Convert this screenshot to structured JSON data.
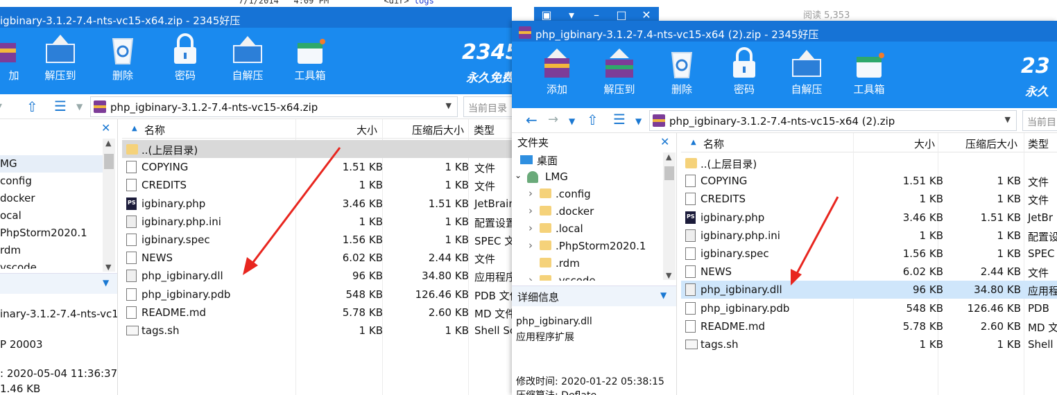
{
  "background": {
    "listing_date": "7/1/2014",
    "listing_time": "4:09 PM",
    "listing_dir": "<dir>",
    "listing_name": "logs",
    "read_count": "阅读 5,353"
  },
  "left_window": {
    "title": "igbinary-3.1.2-7.4-nts-vc15-x64.zip - 2345好压",
    "toolbar": [
      "加",
      "解压到",
      "删除",
      "密码",
      "自解压",
      "工具箱"
    ],
    "brand": "2345",
    "brand_sub": "永久免费",
    "path": "php_igbinary-3.1.2-7.4-nts-vc15-x64.zip",
    "search_placeholder": "当前目录",
    "tree": [
      "MG",
      "config",
      "docker",
      "ocal",
      "PhpStorm2020.1",
      "rdm",
      "vscode"
    ],
    "details": {
      "name": "inary-3.1.2-7.4-nts-vc15",
      "line2": "P 20003",
      "modified": ":  2020-05-04 11:36:37",
      "size": "1.46 KB"
    },
    "columns": {
      "name": "名称",
      "size": "大小",
      "packed": "压缩后大小",
      "type": "类型"
    },
    "files": [
      {
        "name": "..(上层目录)",
        "size": "",
        "packed": "",
        "type": ""
      },
      {
        "name": "COPYING",
        "size": "1.51 KB",
        "packed": "1 KB",
        "type": "文件"
      },
      {
        "name": "CREDITS",
        "size": "1 KB",
        "packed": "1 KB",
        "type": "文件"
      },
      {
        "name": "igbinary.php",
        "size": "3.46 KB",
        "packed": "1.51 KB",
        "type": "JetBrain"
      },
      {
        "name": "igbinary.php.ini",
        "size": "1 KB",
        "packed": "1 KB",
        "type": "配置设置"
      },
      {
        "name": "igbinary.spec",
        "size": "1.56 KB",
        "packed": "1 KB",
        "type": "SPEC 文"
      },
      {
        "name": "NEWS",
        "size": "6.02 KB",
        "packed": "2.44 KB",
        "type": "文件"
      },
      {
        "name": "php_igbinary.dll",
        "size": "96 KB",
        "packed": "34.80 KB",
        "type": "应用程序"
      },
      {
        "name": "php_igbinary.pdb",
        "size": "548 KB",
        "packed": "126.46 KB",
        "type": "PDB 文件"
      },
      {
        "name": "README.md",
        "size": "5.78 KB",
        "packed": "2.60 KB",
        "type": "MD 文件"
      },
      {
        "name": "tags.sh",
        "size": "1 KB",
        "packed": "1 KB",
        "type": "Shell Sc"
      }
    ]
  },
  "right_window": {
    "title": "php_igbinary-3.1.2-7.4-nts-vc15-x64 (2).zip - 2345好压",
    "toolbar": [
      "添加",
      "解压到",
      "删除",
      "密码",
      "自解压",
      "工具箱"
    ],
    "brand": "23",
    "brand_sub": "永久",
    "path": "php_igbinary-3.1.2-7.4-nts-vc15-x64 (2).zip",
    "search_placeholder": "当前目",
    "tree_header": "文件夹",
    "tree": [
      "桌面",
      "LMG",
      ".config",
      ".docker",
      ".local",
      ".PhpStorm2020.1",
      ".rdm",
      ".vscode"
    ],
    "details_header": "详细信息",
    "details": {
      "name": "php_igbinary.dll",
      "type": "应用程序扩展",
      "modified": "修改时间:  2020-01-22 05:38:15",
      "method": "压缩算法:  Deflate"
    },
    "columns": {
      "name": "名称",
      "size": "大小",
      "packed": "压缩后大小",
      "type": "类型"
    },
    "files": [
      {
        "name": "..(上层目录)",
        "size": "",
        "packed": "",
        "type": ""
      },
      {
        "name": "COPYING",
        "size": "1.51 KB",
        "packed": "1 KB",
        "type": "文件"
      },
      {
        "name": "CREDITS",
        "size": "1 KB",
        "packed": "1 KB",
        "type": "文件"
      },
      {
        "name": "igbinary.php",
        "size": "3.46 KB",
        "packed": "1.51 KB",
        "type": "JetBr"
      },
      {
        "name": "igbinary.php.ini",
        "size": "1 KB",
        "packed": "1 KB",
        "type": "配置设"
      },
      {
        "name": "igbinary.spec",
        "size": "1.56 KB",
        "packed": "1 KB",
        "type": "SPEC"
      },
      {
        "name": "NEWS",
        "size": "6.02 KB",
        "packed": "2.44 KB",
        "type": "文件"
      },
      {
        "name": "php_igbinary.dll",
        "size": "96 KB",
        "packed": "34.80 KB",
        "type": "应用程"
      },
      {
        "name": "php_igbinary.pdb",
        "size": "548 KB",
        "packed": "126.46 KB",
        "type": "PDB"
      },
      {
        "name": "README.md",
        "size": "5.78 KB",
        "packed": "2.60 KB",
        "type": "MD 文"
      },
      {
        "name": "tags.sh",
        "size": "1 KB",
        "packed": "1 KB",
        "type": "Shell"
      }
    ]
  },
  "colors": {
    "titlebar": "#1673d6",
    "toolbar": "#1a8aef",
    "selection": "#cfe6fb",
    "arrow": "#e8261f"
  }
}
